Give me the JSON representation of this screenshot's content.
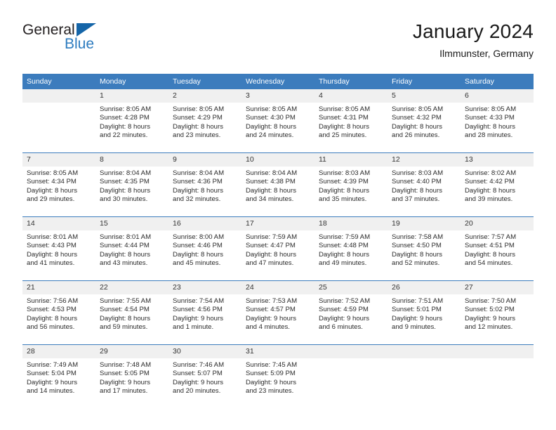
{
  "brand": {
    "name_part1": "General",
    "name_part2": "Blue",
    "triangle_color": "#1565a8",
    "blue_color": "#2c7bbf"
  },
  "header": {
    "title": "January 2024",
    "subtitle": "Ilmmunster, Germany",
    "header_bg": "#3c7cbd",
    "daynum_bg": "#f0f0f0"
  },
  "weekdays": [
    "Sunday",
    "Monday",
    "Tuesday",
    "Wednesday",
    "Thursday",
    "Friday",
    "Saturday"
  ],
  "weeks": [
    [
      {
        "day": "",
        "empty": true,
        "sunrise": "",
        "sunset": "",
        "daylight1": "",
        "daylight2": ""
      },
      {
        "day": "1",
        "sunrise": "Sunrise: 8:05 AM",
        "sunset": "Sunset: 4:28 PM",
        "daylight1": "Daylight: 8 hours",
        "daylight2": "and 22 minutes."
      },
      {
        "day": "2",
        "sunrise": "Sunrise: 8:05 AM",
        "sunset": "Sunset: 4:29 PM",
        "daylight1": "Daylight: 8 hours",
        "daylight2": "and 23 minutes."
      },
      {
        "day": "3",
        "sunrise": "Sunrise: 8:05 AM",
        "sunset": "Sunset: 4:30 PM",
        "daylight1": "Daylight: 8 hours",
        "daylight2": "and 24 minutes."
      },
      {
        "day": "4",
        "sunrise": "Sunrise: 8:05 AM",
        "sunset": "Sunset: 4:31 PM",
        "daylight1": "Daylight: 8 hours",
        "daylight2": "and 25 minutes."
      },
      {
        "day": "5",
        "sunrise": "Sunrise: 8:05 AM",
        "sunset": "Sunset: 4:32 PM",
        "daylight1": "Daylight: 8 hours",
        "daylight2": "and 26 minutes."
      },
      {
        "day": "6",
        "sunrise": "Sunrise: 8:05 AM",
        "sunset": "Sunset: 4:33 PM",
        "daylight1": "Daylight: 8 hours",
        "daylight2": "and 28 minutes."
      }
    ],
    [
      {
        "day": "7",
        "sunrise": "Sunrise: 8:05 AM",
        "sunset": "Sunset: 4:34 PM",
        "daylight1": "Daylight: 8 hours",
        "daylight2": "and 29 minutes."
      },
      {
        "day": "8",
        "sunrise": "Sunrise: 8:04 AM",
        "sunset": "Sunset: 4:35 PM",
        "daylight1": "Daylight: 8 hours",
        "daylight2": "and 30 minutes."
      },
      {
        "day": "9",
        "sunrise": "Sunrise: 8:04 AM",
        "sunset": "Sunset: 4:36 PM",
        "daylight1": "Daylight: 8 hours",
        "daylight2": "and 32 minutes."
      },
      {
        "day": "10",
        "sunrise": "Sunrise: 8:04 AM",
        "sunset": "Sunset: 4:38 PM",
        "daylight1": "Daylight: 8 hours",
        "daylight2": "and 34 minutes."
      },
      {
        "day": "11",
        "sunrise": "Sunrise: 8:03 AM",
        "sunset": "Sunset: 4:39 PM",
        "daylight1": "Daylight: 8 hours",
        "daylight2": "and 35 minutes."
      },
      {
        "day": "12",
        "sunrise": "Sunrise: 8:03 AM",
        "sunset": "Sunset: 4:40 PM",
        "daylight1": "Daylight: 8 hours",
        "daylight2": "and 37 minutes."
      },
      {
        "day": "13",
        "sunrise": "Sunrise: 8:02 AM",
        "sunset": "Sunset: 4:42 PM",
        "daylight1": "Daylight: 8 hours",
        "daylight2": "and 39 minutes."
      }
    ],
    [
      {
        "day": "14",
        "sunrise": "Sunrise: 8:01 AM",
        "sunset": "Sunset: 4:43 PM",
        "daylight1": "Daylight: 8 hours",
        "daylight2": "and 41 minutes."
      },
      {
        "day": "15",
        "sunrise": "Sunrise: 8:01 AM",
        "sunset": "Sunset: 4:44 PM",
        "daylight1": "Daylight: 8 hours",
        "daylight2": "and 43 minutes."
      },
      {
        "day": "16",
        "sunrise": "Sunrise: 8:00 AM",
        "sunset": "Sunset: 4:46 PM",
        "daylight1": "Daylight: 8 hours",
        "daylight2": "and 45 minutes."
      },
      {
        "day": "17",
        "sunrise": "Sunrise: 7:59 AM",
        "sunset": "Sunset: 4:47 PM",
        "daylight1": "Daylight: 8 hours",
        "daylight2": "and 47 minutes."
      },
      {
        "day": "18",
        "sunrise": "Sunrise: 7:59 AM",
        "sunset": "Sunset: 4:48 PM",
        "daylight1": "Daylight: 8 hours",
        "daylight2": "and 49 minutes."
      },
      {
        "day": "19",
        "sunrise": "Sunrise: 7:58 AM",
        "sunset": "Sunset: 4:50 PM",
        "daylight1": "Daylight: 8 hours",
        "daylight2": "and 52 minutes."
      },
      {
        "day": "20",
        "sunrise": "Sunrise: 7:57 AM",
        "sunset": "Sunset: 4:51 PM",
        "daylight1": "Daylight: 8 hours",
        "daylight2": "and 54 minutes."
      }
    ],
    [
      {
        "day": "21",
        "sunrise": "Sunrise: 7:56 AM",
        "sunset": "Sunset: 4:53 PM",
        "daylight1": "Daylight: 8 hours",
        "daylight2": "and 56 minutes."
      },
      {
        "day": "22",
        "sunrise": "Sunrise: 7:55 AM",
        "sunset": "Sunset: 4:54 PM",
        "daylight1": "Daylight: 8 hours",
        "daylight2": "and 59 minutes."
      },
      {
        "day": "23",
        "sunrise": "Sunrise: 7:54 AM",
        "sunset": "Sunset: 4:56 PM",
        "daylight1": "Daylight: 9 hours",
        "daylight2": "and 1 minute."
      },
      {
        "day": "24",
        "sunrise": "Sunrise: 7:53 AM",
        "sunset": "Sunset: 4:57 PM",
        "daylight1": "Daylight: 9 hours",
        "daylight2": "and 4 minutes."
      },
      {
        "day": "25",
        "sunrise": "Sunrise: 7:52 AM",
        "sunset": "Sunset: 4:59 PM",
        "daylight1": "Daylight: 9 hours",
        "daylight2": "and 6 minutes."
      },
      {
        "day": "26",
        "sunrise": "Sunrise: 7:51 AM",
        "sunset": "Sunset: 5:01 PM",
        "daylight1": "Daylight: 9 hours",
        "daylight2": "and 9 minutes."
      },
      {
        "day": "27",
        "sunrise": "Sunrise: 7:50 AM",
        "sunset": "Sunset: 5:02 PM",
        "daylight1": "Daylight: 9 hours",
        "daylight2": "and 12 minutes."
      }
    ],
    [
      {
        "day": "28",
        "sunrise": "Sunrise: 7:49 AM",
        "sunset": "Sunset: 5:04 PM",
        "daylight1": "Daylight: 9 hours",
        "daylight2": "and 14 minutes."
      },
      {
        "day": "29",
        "sunrise": "Sunrise: 7:48 AM",
        "sunset": "Sunset: 5:05 PM",
        "daylight1": "Daylight: 9 hours",
        "daylight2": "and 17 minutes."
      },
      {
        "day": "30",
        "sunrise": "Sunrise: 7:46 AM",
        "sunset": "Sunset: 5:07 PM",
        "daylight1": "Daylight: 9 hours",
        "daylight2": "and 20 minutes."
      },
      {
        "day": "31",
        "sunrise": "Sunrise: 7:45 AM",
        "sunset": "Sunset: 5:09 PM",
        "daylight1": "Daylight: 9 hours",
        "daylight2": "and 23 minutes."
      },
      {
        "day": "",
        "empty": true,
        "sunrise": "",
        "sunset": "",
        "daylight1": "",
        "daylight2": ""
      },
      {
        "day": "",
        "empty": true,
        "sunrise": "",
        "sunset": "",
        "daylight1": "",
        "daylight2": ""
      },
      {
        "day": "",
        "empty": true,
        "sunrise": "",
        "sunset": "",
        "daylight1": "",
        "daylight2": ""
      }
    ]
  ]
}
